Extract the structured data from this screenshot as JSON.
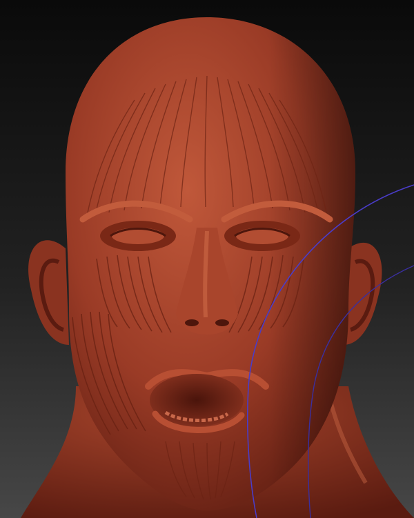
{
  "scene": {
    "subject": "sculpted-head-muscle-study",
    "colors": {
      "background_top": "#0a0a0a",
      "background_bottom": "#444444",
      "clay": "#9a3b26",
      "clay_light": "#c0583a",
      "clay_dark": "#5a1b10",
      "gizmo_ring": "#4a3cc8"
    }
  }
}
